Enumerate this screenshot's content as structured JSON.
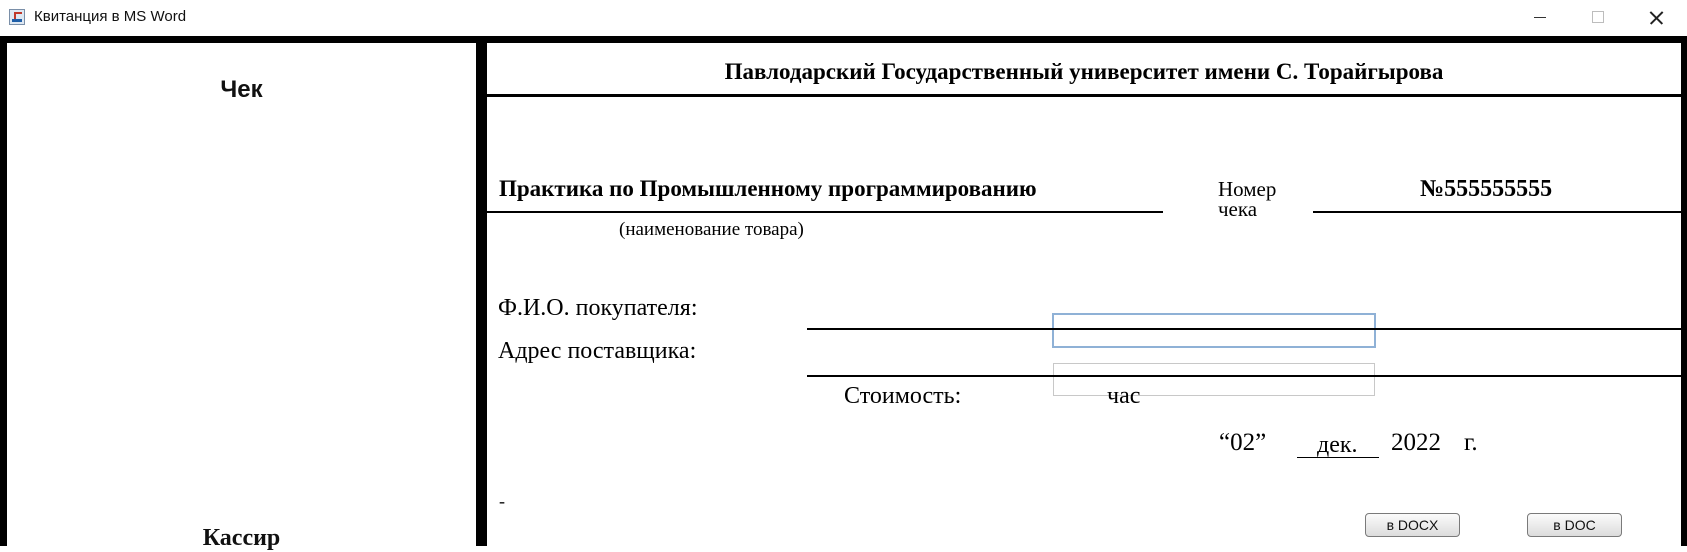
{
  "window": {
    "title": "Квитанция в MS Word",
    "icon": "java-cup-icon"
  },
  "stub": {
    "title": "Чек",
    "cashier_label": "Кассир"
  },
  "receipt": {
    "university": "Павлодарский Государственный университет имени С. Торайгырова",
    "product_name": "Практика по Промышленному программированию",
    "product_caption": "(наименование товара)",
    "number_label_line1": "Номер",
    "number_label_line2": "чека",
    "number_value": "№555555555",
    "buyer_label": "Ф.И.О. покупателя:",
    "buyer_value": "",
    "supplier_label": "Адрес поставщика:",
    "supplier_value": "",
    "cost_label": "Стоимость:",
    "cost_unit": "час",
    "date_day": "“02”",
    "date_month": "дек.",
    "date_year": "2022",
    "date_suffix": "г.",
    "footer_mark": "-"
  },
  "buttons": {
    "docx": "в DOCX",
    "doc": "в DOC"
  }
}
